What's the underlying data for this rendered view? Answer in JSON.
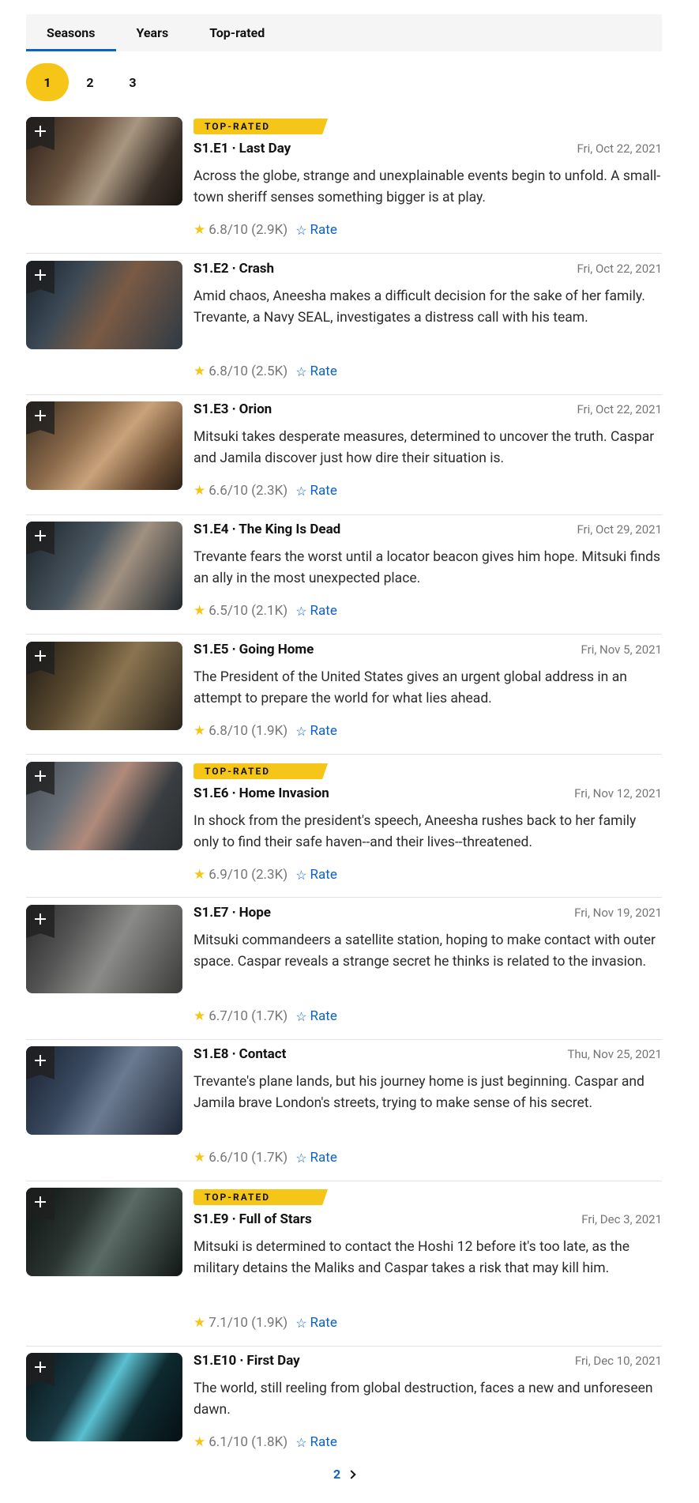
{
  "tabs": [
    {
      "label": "Seasons"
    },
    {
      "label": "Years"
    },
    {
      "label": "Top-rated"
    }
  ],
  "seasons": [
    "1",
    "2",
    "3"
  ],
  "badge_label": "TOP-RATED",
  "rate_label": "Rate",
  "episodes": [
    {
      "title": "S1.E1 ∙ Last Day",
      "date": "Fri, Oct 22, 2021",
      "desc": "Across the globe, strange and unexplainable events begin to unfold. A small-town sheriff senses something bigger is at play.",
      "rating": "6.8/10 (2.9K)",
      "top": true
    },
    {
      "title": "S1.E2 ∙ Crash",
      "date": "Fri, Oct 22, 2021",
      "desc": "Amid chaos, Aneesha makes a difficult decision for the sake of her family. Trevante, a Navy SEAL, investigates a distress call with his team.",
      "rating": "6.8/10 (2.5K)",
      "top": false
    },
    {
      "title": "S1.E3 ∙ Orion",
      "date": "Fri, Oct 22, 2021",
      "desc": "Mitsuki takes desperate measures, determined to uncover the truth. Caspar and Jamila discover just how dire their situation is.",
      "rating": "6.6/10 (2.3K)",
      "top": false
    },
    {
      "title": "S1.E4 ∙ The King Is Dead",
      "date": "Fri, Oct 29, 2021",
      "desc": "Trevante fears the worst until a locator beacon gives him hope. Mitsuki finds an ally in the most unexpected place.",
      "rating": "6.5/10 (2.1K)",
      "top": false
    },
    {
      "title": "S1.E5 ∙ Going Home",
      "date": "Fri, Nov 5, 2021",
      "desc": "The President of the United States gives an urgent global address in an attempt to prepare the world for what lies ahead.",
      "rating": "6.8/10 (1.9K)",
      "top": false
    },
    {
      "title": "S1.E6 ∙ Home Invasion",
      "date": "Fri, Nov 12, 2021",
      "desc": "In shock from the president's speech, Aneesha rushes back to her family only to find their safe haven--and their lives--threatened.",
      "rating": "6.9/10 (2.3K)",
      "top": true
    },
    {
      "title": "S1.E7 ∙ Hope",
      "date": "Fri, Nov 19, 2021",
      "desc": "Mitsuki commandeers a satellite station, hoping to make contact with outer space. Caspar reveals a strange secret he thinks is related to the invasion.",
      "rating": "6.7/10 (1.7K)",
      "top": false
    },
    {
      "title": "S1.E8 ∙ Contact",
      "date": "Thu, Nov 25, 2021",
      "desc": "Trevante's plane lands, but his journey home is just beginning. Caspar and Jamila brave London's streets, trying to make sense of his secret.",
      "rating": "6.6/10 (1.7K)",
      "top": false
    },
    {
      "title": "S1.E9 ∙ Full of Stars",
      "date": "Fri, Dec 3, 2021",
      "desc": "Mitsuki is determined to contact the Hoshi 12 before it's too late, as the military detains the Maliks and Caspar takes a risk that may kill him.",
      "rating": "7.1/10 (1.9K)",
      "top": true
    },
    {
      "title": "S1.E10 ∙ First Day",
      "date": "Fri, Dec 10, 2021",
      "desc": "The world, still reeling from global destruction, faces a new and unforeseen dawn.",
      "rating": "6.1/10 (1.8K)",
      "top": false
    }
  ],
  "pagination": {
    "next_label": "2"
  },
  "colors": {
    "accent": "#f5c518",
    "link": "#0e63be"
  }
}
